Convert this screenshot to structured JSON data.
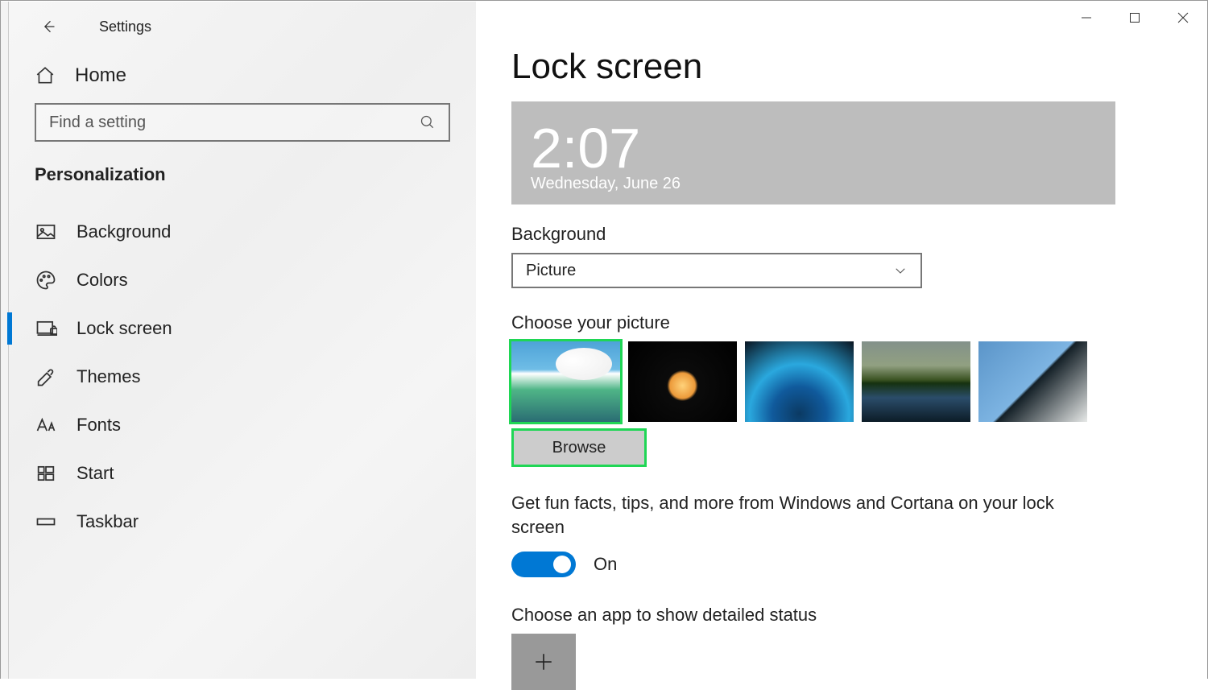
{
  "app_title": "Settings",
  "home_label": "Home",
  "search": {
    "placeholder": "Find a setting"
  },
  "category": "Personalization",
  "nav": {
    "items": [
      {
        "label": "Background",
        "active": false
      },
      {
        "label": "Colors",
        "active": false
      },
      {
        "label": "Lock screen",
        "active": true
      },
      {
        "label": "Themes",
        "active": false
      },
      {
        "label": "Fonts",
        "active": false
      },
      {
        "label": "Start",
        "active": false
      },
      {
        "label": "Taskbar",
        "active": false
      }
    ]
  },
  "page_title": "Lock screen",
  "preview": {
    "time": "2:07",
    "date": "Wednesday, June 26"
  },
  "background": {
    "label": "Background",
    "selected": "Picture"
  },
  "choose_picture_label": "Choose your picture",
  "browse_label": "Browse",
  "funfacts": {
    "label": "Get fun facts, tips, and more from Windows and Cortana on your lock screen",
    "state": "On"
  },
  "detailed_status_label": "Choose an app to show detailed status",
  "colors": {
    "accent": "#0078d4",
    "highlight": "#1fd655"
  }
}
